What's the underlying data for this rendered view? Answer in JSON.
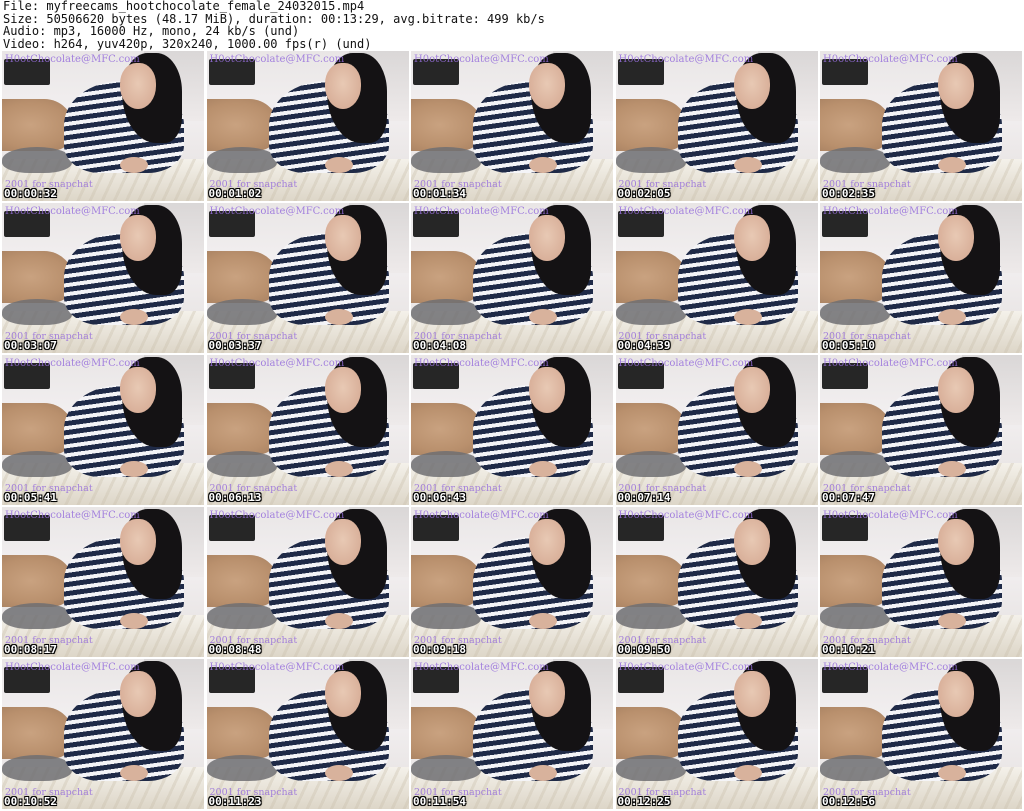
{
  "header": {
    "file": "File: myfreecams_hootchocolate_female_24032015.mp4",
    "size": "Size: 50506620 bytes (48.17 MiB), duration: 00:13:29, avg.bitrate: 499 kb/s",
    "audio": "Audio: mp3, 16000 Hz, mono, 24 kb/s (und)",
    "video": "Video: h264, yuv420p, 320x240, 1000.00 fps(r) (und)"
  },
  "watermark_top": "H0otChocolate@MFC.com",
  "watermark_bottom": "2001 for snapchat",
  "thumbnails": [
    {
      "timestamp": "00:00:32"
    },
    {
      "timestamp": "00:01:02"
    },
    {
      "timestamp": "00:01:34"
    },
    {
      "timestamp": "00:02:05"
    },
    {
      "timestamp": "00:02:35"
    },
    {
      "timestamp": "00:03:07"
    },
    {
      "timestamp": "00:03:37"
    },
    {
      "timestamp": "00:04:08"
    },
    {
      "timestamp": "00:04:39"
    },
    {
      "timestamp": "00:05:10"
    },
    {
      "timestamp": "00:05:41"
    },
    {
      "timestamp": "00:06:13"
    },
    {
      "timestamp": "00:06:43"
    },
    {
      "timestamp": "00:07:14"
    },
    {
      "timestamp": "00:07:47"
    },
    {
      "timestamp": "00:08:17"
    },
    {
      "timestamp": "00:08:48"
    },
    {
      "timestamp": "00:09:18"
    },
    {
      "timestamp": "00:09:50"
    },
    {
      "timestamp": "00:10:21"
    },
    {
      "timestamp": "00:10:52"
    },
    {
      "timestamp": "00:11:23"
    },
    {
      "timestamp": "00:11:54"
    },
    {
      "timestamp": "00:12:25"
    },
    {
      "timestamp": "00:12:56"
    }
  ]
}
